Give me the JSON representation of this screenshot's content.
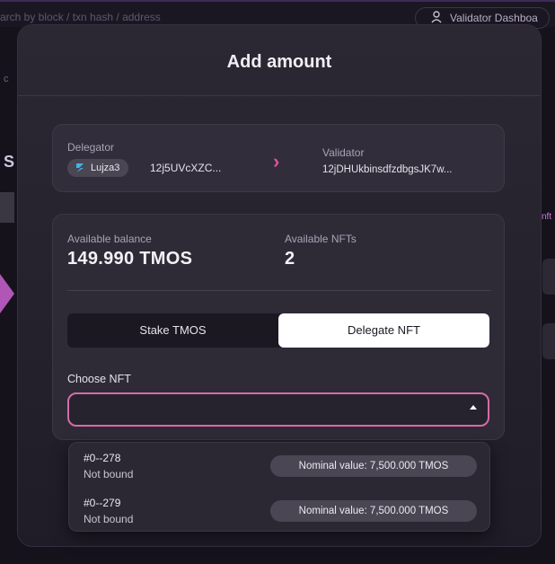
{
  "background": {
    "search_placeholder": "arch by block / txn hash / address",
    "validator_dashboard": "Validator Dashboa",
    "left_letter": "S",
    "left_text": "c",
    "right_text": "nft"
  },
  "modal": {
    "title": "Add amount",
    "delegator": {
      "label": "Delegator",
      "name": "Lujza3",
      "address": "12j5UVcXZC..."
    },
    "arrow": "›",
    "validator": {
      "label": "Validator",
      "address": "12jDHUkbinsdfzdbgsJK7w..."
    },
    "balance": {
      "label": "Available balance",
      "value": "149.990 TMOS"
    },
    "nfts": {
      "label": "Available NFTs",
      "value": "2"
    },
    "tabs": [
      {
        "label": "Stake TMOS",
        "active": false
      },
      {
        "label": "Delegate NFT",
        "active": true
      }
    ],
    "choose_nft_label": "Choose NFT",
    "select_value": "",
    "dropdown_options": [
      {
        "name": "#0--278",
        "status": "Not bound",
        "nominal": "Nominal value: 7,500.000 TMOS"
      },
      {
        "name": "#0--279",
        "status": "Not bound",
        "nominal": "Nominal value: 7,500.000 TMOS"
      }
    ]
  },
  "colors": {
    "accent_pink": "#d86aa9",
    "arrow_pink": "#e24fa0",
    "modal_bg": "#2b2833",
    "active_tab": "#ffffff"
  },
  "icons": [
    "validator-icon",
    "token-logo-icon",
    "chevron-right-icon",
    "caret-up-icon"
  ]
}
